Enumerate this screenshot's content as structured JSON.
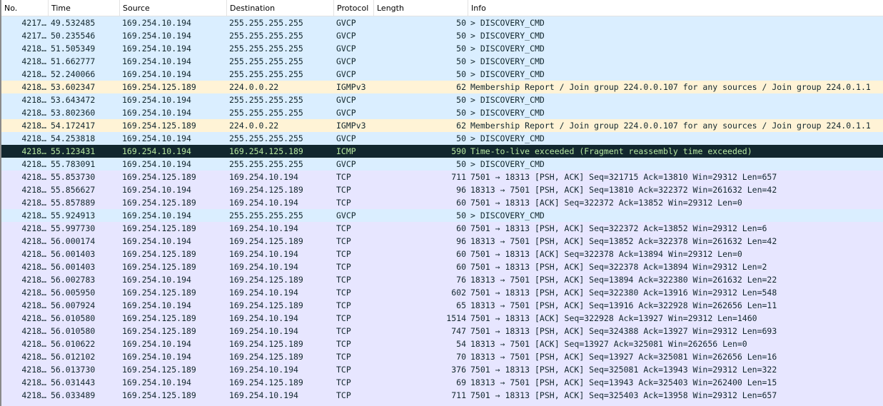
{
  "columns": [
    "No.",
    "Time",
    "Source",
    "Destination",
    "Protocol",
    "Length",
    "Info"
  ],
  "colors": {
    "gvcp": "#daeeff",
    "igmp": "#fff3d6",
    "tcp": "#e7e6ff",
    "icmp": "#12272e",
    "icmp_text": "#b5e6a0"
  },
  "packets": [
    {
      "no": "4217…",
      "time": "49.532485",
      "src": "169.254.10.194",
      "dst": "255.255.255.255",
      "proto": "GVCP",
      "len": "50",
      "info": "> DISCOVERY_CMD",
      "cls": "gvcp"
    },
    {
      "no": "4217…",
      "time": "50.235546",
      "src": "169.254.10.194",
      "dst": "255.255.255.255",
      "proto": "GVCP",
      "len": "50",
      "info": "> DISCOVERY_CMD",
      "cls": "gvcp"
    },
    {
      "no": "4218…",
      "time": "51.505349",
      "src": "169.254.10.194",
      "dst": "255.255.255.255",
      "proto": "GVCP",
      "len": "50",
      "info": "> DISCOVERY_CMD",
      "cls": "gvcp"
    },
    {
      "no": "4218…",
      "time": "51.662777",
      "src": "169.254.10.194",
      "dst": "255.255.255.255",
      "proto": "GVCP",
      "len": "50",
      "info": "> DISCOVERY_CMD",
      "cls": "gvcp"
    },
    {
      "no": "4218…",
      "time": "52.240066",
      "src": "169.254.10.194",
      "dst": "255.255.255.255",
      "proto": "GVCP",
      "len": "50",
      "info": "> DISCOVERY_CMD",
      "cls": "gvcp"
    },
    {
      "no": "4218…",
      "time": "53.602347",
      "src": "169.254.125.189",
      "dst": "224.0.0.22",
      "proto": "IGMPv3",
      "len": "62",
      "info": "Membership Report / Join group 224.0.0.107 for any sources / Join group 224.0.1.1",
      "cls": "igmp"
    },
    {
      "no": "4218…",
      "time": "53.643472",
      "src": "169.254.10.194",
      "dst": "255.255.255.255",
      "proto": "GVCP",
      "len": "50",
      "info": "> DISCOVERY_CMD",
      "cls": "gvcp"
    },
    {
      "no": "4218…",
      "time": "53.802360",
      "src": "169.254.10.194",
      "dst": "255.255.255.255",
      "proto": "GVCP",
      "len": "50",
      "info": "> DISCOVERY_CMD",
      "cls": "gvcp"
    },
    {
      "no": "4218…",
      "time": "54.172417",
      "src": "169.254.125.189",
      "dst": "224.0.0.22",
      "proto": "IGMPv3",
      "len": "62",
      "info": "Membership Report / Join group 224.0.0.107 for any sources / Join group 224.0.1.1",
      "cls": "igmp"
    },
    {
      "no": "4218…",
      "time": "54.253818",
      "src": "169.254.10.194",
      "dst": "255.255.255.255",
      "proto": "GVCP",
      "len": "50",
      "info": "> DISCOVERY_CMD",
      "cls": "gvcp"
    },
    {
      "no": "4218…",
      "time": "55.123431",
      "src": "169.254.10.194",
      "dst": "169.254.125.189",
      "proto": "ICMP",
      "len": "590",
      "info": "Time-to-live exceeded (Fragment reassembly time exceeded)",
      "cls": "icmp"
    },
    {
      "no": "4218…",
      "time": "55.783091",
      "src": "169.254.10.194",
      "dst": "255.255.255.255",
      "proto": "GVCP",
      "len": "50",
      "info": "> DISCOVERY_CMD",
      "cls": "gvcp"
    },
    {
      "no": "4218…",
      "time": "55.853730",
      "src": "169.254.125.189",
      "dst": "169.254.10.194",
      "proto": "TCP",
      "len": "711",
      "info": "7501 → 18313 [PSH, ACK] Seq=321715 Ack=13810 Win=29312 Len=657",
      "cls": "tcp"
    },
    {
      "no": "4218…",
      "time": "55.856627",
      "src": "169.254.10.194",
      "dst": "169.254.125.189",
      "proto": "TCP",
      "len": "96",
      "info": "18313 → 7501 [PSH, ACK] Seq=13810 Ack=322372 Win=261632 Len=42",
      "cls": "tcp"
    },
    {
      "no": "4218…",
      "time": "55.857889",
      "src": "169.254.125.189",
      "dst": "169.254.10.194",
      "proto": "TCP",
      "len": "60",
      "info": "7501 → 18313 [ACK] Seq=322372 Ack=13852 Win=29312 Len=0",
      "cls": "tcp"
    },
    {
      "no": "4218…",
      "time": "55.924913",
      "src": "169.254.10.194",
      "dst": "255.255.255.255",
      "proto": "GVCP",
      "len": "50",
      "info": "> DISCOVERY_CMD",
      "cls": "gvcp"
    },
    {
      "no": "4218…",
      "time": "55.997730",
      "src": "169.254.125.189",
      "dst": "169.254.10.194",
      "proto": "TCP",
      "len": "60",
      "info": "7501 → 18313 [PSH, ACK] Seq=322372 Ack=13852 Win=29312 Len=6",
      "cls": "tcp"
    },
    {
      "no": "4218…",
      "time": "56.000174",
      "src": "169.254.10.194",
      "dst": "169.254.125.189",
      "proto": "TCP",
      "len": "96",
      "info": "18313 → 7501 [PSH, ACK] Seq=13852 Ack=322378 Win=261632 Len=42",
      "cls": "tcp"
    },
    {
      "no": "4218…",
      "time": "56.001403",
      "src": "169.254.125.189",
      "dst": "169.254.10.194",
      "proto": "TCP",
      "len": "60",
      "info": "7501 → 18313 [ACK] Seq=322378 Ack=13894 Win=29312 Len=0",
      "cls": "tcp"
    },
    {
      "no": "4218…",
      "time": "56.001403",
      "src": "169.254.125.189",
      "dst": "169.254.10.194",
      "proto": "TCP",
      "len": "60",
      "info": "7501 → 18313 [PSH, ACK] Seq=322378 Ack=13894 Win=29312 Len=2",
      "cls": "tcp"
    },
    {
      "no": "4218…",
      "time": "56.002783",
      "src": "169.254.10.194",
      "dst": "169.254.125.189",
      "proto": "TCP",
      "len": "76",
      "info": "18313 → 7501 [PSH, ACK] Seq=13894 Ack=322380 Win=261632 Len=22",
      "cls": "tcp"
    },
    {
      "no": "4218…",
      "time": "56.005950",
      "src": "169.254.125.189",
      "dst": "169.254.10.194",
      "proto": "TCP",
      "len": "602",
      "info": "7501 → 18313 [PSH, ACK] Seq=322380 Ack=13916 Win=29312 Len=548",
      "cls": "tcp"
    },
    {
      "no": "4218…",
      "time": "56.007924",
      "src": "169.254.10.194",
      "dst": "169.254.125.189",
      "proto": "TCP",
      "len": "65",
      "info": "18313 → 7501 [PSH, ACK] Seq=13916 Ack=322928 Win=262656 Len=11",
      "cls": "tcp"
    },
    {
      "no": "4218…",
      "time": "56.010580",
      "src": "169.254.125.189",
      "dst": "169.254.10.194",
      "proto": "TCP",
      "len": "1514",
      "info": "7501 → 18313 [ACK] Seq=322928 Ack=13927 Win=29312 Len=1460",
      "cls": "tcp"
    },
    {
      "no": "4218…",
      "time": "56.010580",
      "src": "169.254.125.189",
      "dst": "169.254.10.194",
      "proto": "TCP",
      "len": "747",
      "info": "7501 → 18313 [PSH, ACK] Seq=324388 Ack=13927 Win=29312 Len=693",
      "cls": "tcp"
    },
    {
      "no": "4218…",
      "time": "56.010622",
      "src": "169.254.10.194",
      "dst": "169.254.125.189",
      "proto": "TCP",
      "len": "54",
      "info": "18313 → 7501 [ACK] Seq=13927 Ack=325081 Win=262656 Len=0",
      "cls": "tcp"
    },
    {
      "no": "4218…",
      "time": "56.012102",
      "src": "169.254.10.194",
      "dst": "169.254.125.189",
      "proto": "TCP",
      "len": "70",
      "info": "18313 → 7501 [PSH, ACK] Seq=13927 Ack=325081 Win=262656 Len=16",
      "cls": "tcp"
    },
    {
      "no": "4218…",
      "time": "56.013730",
      "src": "169.254.125.189",
      "dst": "169.254.10.194",
      "proto": "TCP",
      "len": "376",
      "info": "7501 → 18313 [PSH, ACK] Seq=325081 Ack=13943 Win=29312 Len=322",
      "cls": "tcp"
    },
    {
      "no": "4218…",
      "time": "56.031443",
      "src": "169.254.10.194",
      "dst": "169.254.125.189",
      "proto": "TCP",
      "len": "69",
      "info": "18313 → 7501 [PSH, ACK] Seq=13943 Ack=325403 Win=262400 Len=15",
      "cls": "tcp"
    },
    {
      "no": "4218…",
      "time": "56.033489",
      "src": "169.254.125.189",
      "dst": "169.254.10.194",
      "proto": "TCP",
      "len": "711",
      "info": "7501 → 18313 [PSH, ACK] Seq=325403 Ack=13958 Win=29312 Len=657",
      "cls": "tcp"
    }
  ]
}
